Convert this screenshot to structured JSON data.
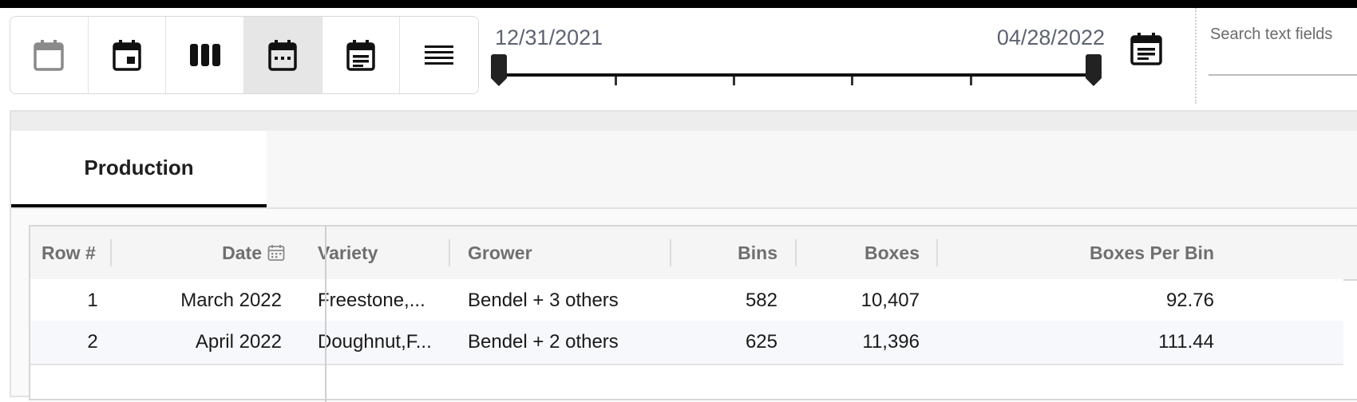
{
  "toolbar": {
    "view_buttons": [
      {
        "icon": "calendar-blank-icon",
        "active": false
      },
      {
        "icon": "calendar-day-icon",
        "active": false
      },
      {
        "icon": "columns-icon",
        "active": false
      },
      {
        "icon": "calendar-dots-icon",
        "active": true
      },
      {
        "icon": "calendar-list-icon",
        "active": false
      },
      {
        "icon": "rows-icon",
        "active": false
      }
    ]
  },
  "date_range": {
    "start": "12/31/2021",
    "end": "04/28/2022"
  },
  "search": {
    "placeholder": "Search text fields"
  },
  "tabs": [
    {
      "label": "Production",
      "active": true
    }
  ],
  "table": {
    "columns": [
      "Row #",
      "Date",
      "Variety",
      "Grower",
      "Bins",
      "Boxes",
      "Boxes Per Bin"
    ],
    "rows": [
      {
        "row": "1",
        "date": "March 2022",
        "variety": "Freestone,...",
        "grower": "Bendel + 3 others",
        "bins": "582",
        "boxes": "10,407",
        "boxes_per_bin": "92.76"
      },
      {
        "row": "2",
        "date": "April 2022",
        "variety": "Doughnut,F...",
        "grower": "Bendel + 2 others",
        "bins": "625",
        "boxes": "11,396",
        "boxes_per_bin": "111.44"
      }
    ]
  }
}
